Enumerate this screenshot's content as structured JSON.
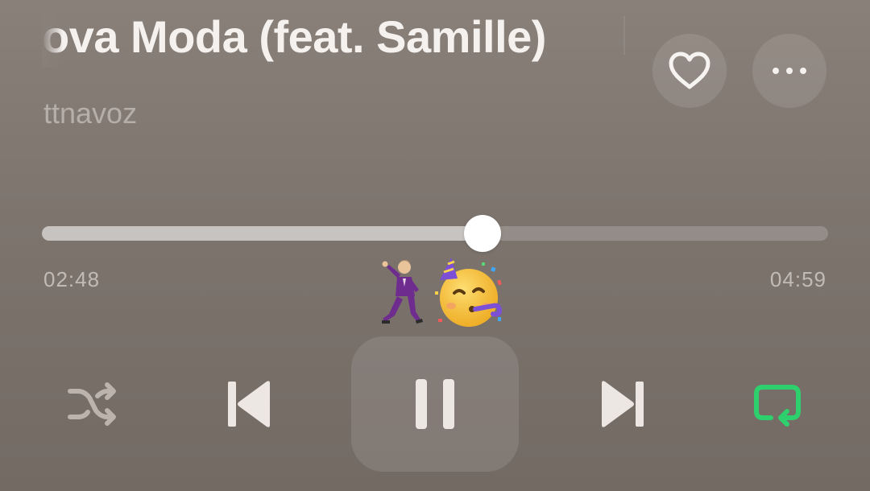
{
  "track": {
    "title": "ova Moda (feat. Samille)",
    "artist": "ttnavoz"
  },
  "progress": {
    "elapsed": "02:48",
    "total": "04:59",
    "fraction": 0.56
  },
  "decorations": {
    "emoji_1": "🕺🏼",
    "emoji_2": "🥳"
  },
  "controls": {
    "shuffle_icon": "shuffle-icon",
    "previous_icon": "skip-back-icon",
    "play_pause_icon": "pause-icon",
    "next_icon": "skip-forward-icon",
    "repeat_icon": "repeat-icon",
    "repeat_color": "#2ed06e",
    "favorite_icon": "heart-icon",
    "more_icon": "ellipsis-icon"
  }
}
